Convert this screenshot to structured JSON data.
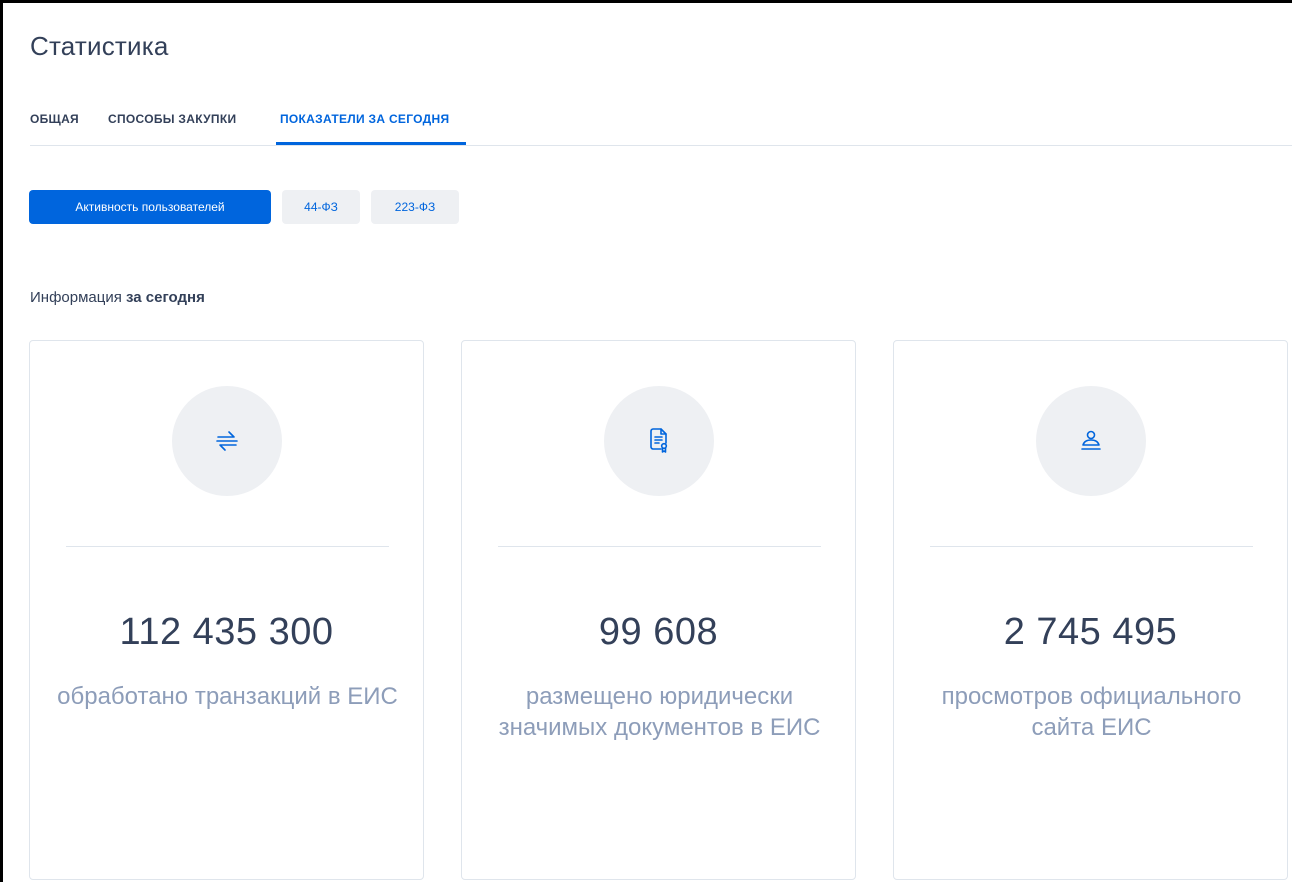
{
  "page": {
    "title": "Статистика"
  },
  "tabs": [
    {
      "label": "ОБЩАЯ",
      "active": false
    },
    {
      "label": "СПОСОБЫ ЗАКУПКИ",
      "active": false
    },
    {
      "label": "ПОКАЗАТЕЛИ ЗА СЕГОДНЯ",
      "active": true
    }
  ],
  "filters": [
    {
      "label": "Активность пользователей",
      "selected": true
    },
    {
      "label": "44-ФЗ",
      "selected": false
    },
    {
      "label": "223-ФЗ",
      "selected": false
    }
  ],
  "section": {
    "heading_prefix": "Информация ",
    "heading_bold": "за сегодня"
  },
  "cards": [
    {
      "icon": "transactions-icon",
      "value": "112 435 300",
      "label": "обработано транзакций в ЕИС"
    },
    {
      "icon": "document-certificate-icon",
      "value": "99 608",
      "label": "размещено юридически значимых документов в ЕИС"
    },
    {
      "icon": "user-icon",
      "value": "2 745 495",
      "label": "просмотров официального сайта ЕИС"
    }
  ],
  "colors": {
    "accent": "#0065dd",
    "text_dark": "#334059",
    "text_muted": "#8d9db9",
    "chip_bg": "#eef0f3",
    "border": "#dfe5ec"
  }
}
